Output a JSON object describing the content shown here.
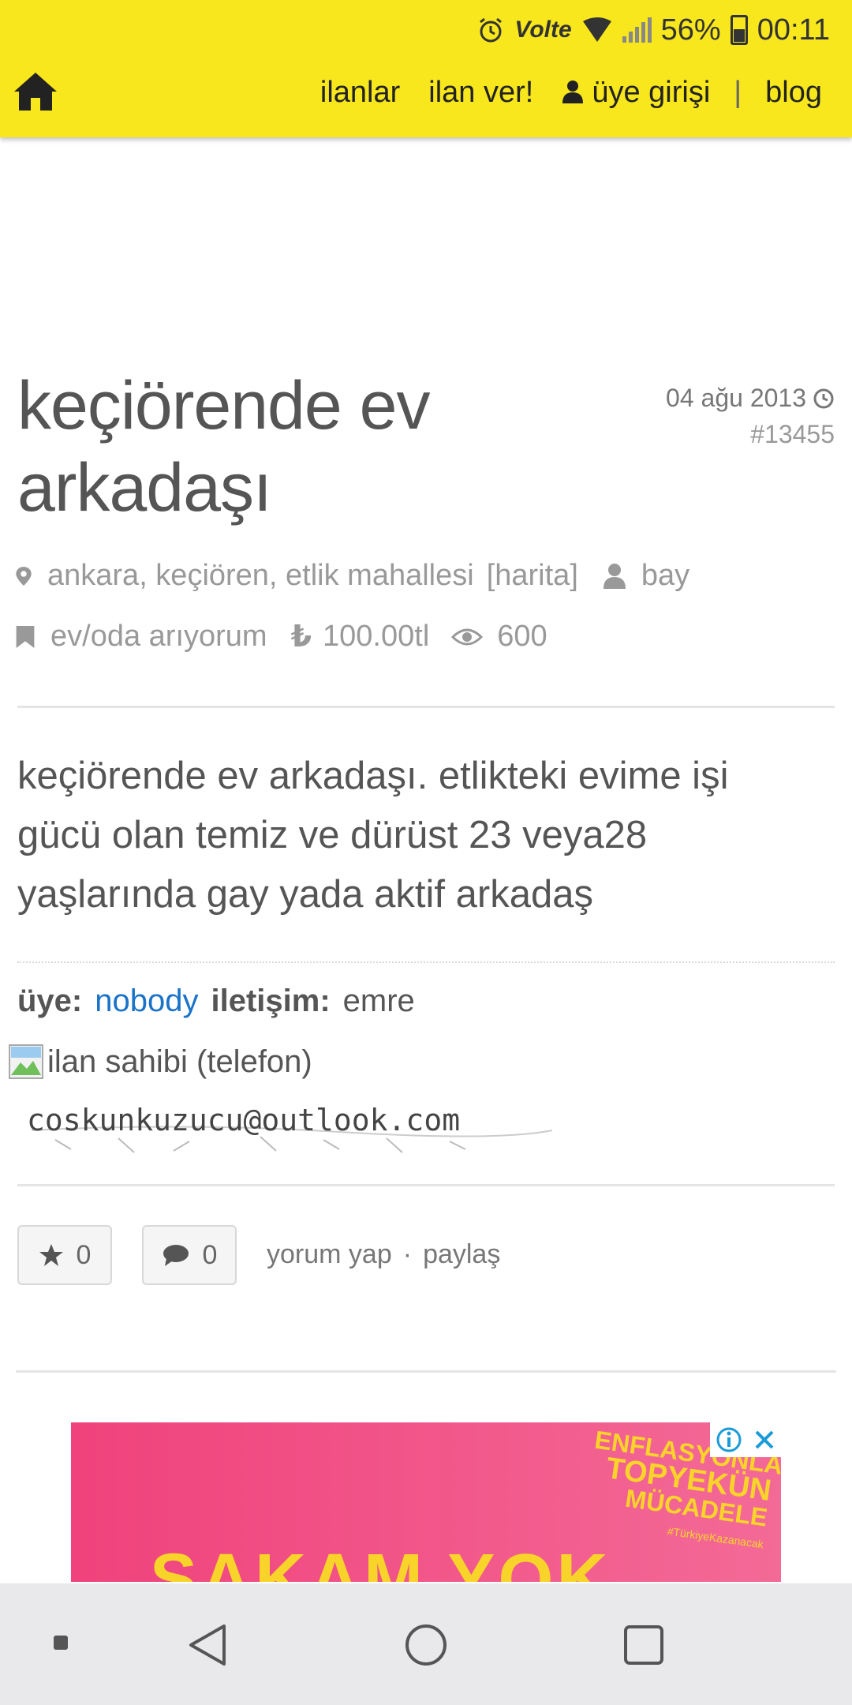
{
  "status_bar": {
    "volte": "Volte",
    "battery": "56%",
    "time": "00:11"
  },
  "nav": {
    "listings": "ilanlar",
    "post_listing": "ilan ver!",
    "login": "üye girişi",
    "separator": "|",
    "blog": "blog"
  },
  "listing": {
    "title": "keçiörende ev arkadaşı",
    "date": "04 ağu 2013",
    "id": "#13455",
    "location": "ankara, keçiören, etlik mahallesi",
    "map_link": "[harita]",
    "gender": "bay",
    "category": "ev/oda arıyorum",
    "price": "100.00tl",
    "views": "600",
    "description": "keçiörende ev arkadaşı. etlikteki evime işi gücü olan temiz ve dürüst 23 veya28 yaşlarında gay yada aktif arkadaş",
    "member_label": "üye:",
    "member": "nobody",
    "contact_label": "iletişim:",
    "contact": "emre",
    "phone_alt": "ilan sahibi (telefon)",
    "email": "coskunkuzucu@outlook.com"
  },
  "actions": {
    "stars": "0",
    "comments": "0",
    "comment_link": "yorum yap",
    "dot": "·",
    "share_link": "paylaş"
  },
  "ad": {
    "line1": "ENFLASYONLA",
    "line2": "TOPYEKÜN",
    "line3": "MÜCADELE",
    "hashtag": "#TürkiyeKazanacak",
    "headline": "ŞAKAM YOK"
  },
  "colors": {
    "header": "#f8e71c",
    "link": "#1a73c8",
    "ad_bg": "#f0427c"
  }
}
